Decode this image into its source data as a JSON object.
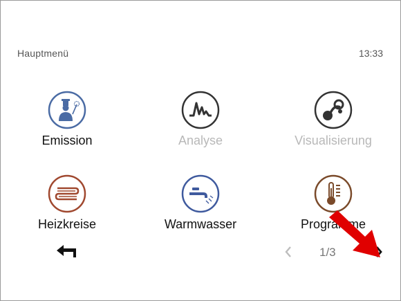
{
  "header": {
    "title": "Hauptmenü",
    "clock": "13:33"
  },
  "menu": {
    "items": [
      {
        "label": "Emission",
        "icon": "chimney-sweep-icon",
        "color": "#4a6ba4",
        "enabled": true
      },
      {
        "label": "Analyse",
        "icon": "peak-graph-icon",
        "color": "#333333",
        "enabled": false
      },
      {
        "label": "Visualisierung",
        "icon": "visualization-icon",
        "color": "#333333",
        "enabled": false
      },
      {
        "label": "Heizkreise",
        "icon": "heating-circuit-icon",
        "color": "#a0482f",
        "enabled": true
      },
      {
        "label": "Warmwasser",
        "icon": "faucet-icon",
        "color": "#3f5a9e",
        "enabled": true
      },
      {
        "label": "Programme",
        "icon": "thermometer-list-icon",
        "color": "#7a4a2a",
        "enabled": true
      }
    ]
  },
  "footer": {
    "page_indicator": "1/3"
  },
  "colors": {
    "disabled_text": "#b8b8b8",
    "annotation_arrow": "#e00000"
  }
}
